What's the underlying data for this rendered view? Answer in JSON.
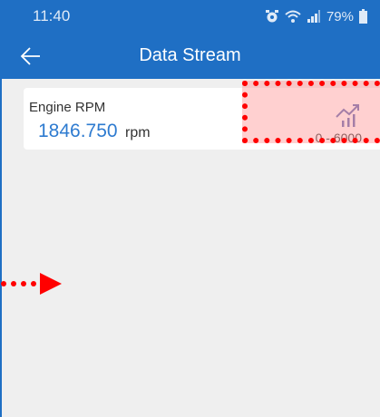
{
  "status_bar": {
    "time": "11:40",
    "battery": "79%"
  },
  "app_bar": {
    "title": "Data Stream",
    "back_icon": "arrow-left-icon"
  },
  "data_stream": {
    "items": [
      {
        "name": "Engine RPM",
        "value": "1846.750",
        "unit": "rpm",
        "range": "0 - 6000",
        "graph_icon": "trend-chart-icon"
      }
    ]
  },
  "colors": {
    "primary": "#1f6fc4",
    "value_blue": "#2e7bd0",
    "annotation_red": "#ff0000",
    "background": "#efefef"
  }
}
